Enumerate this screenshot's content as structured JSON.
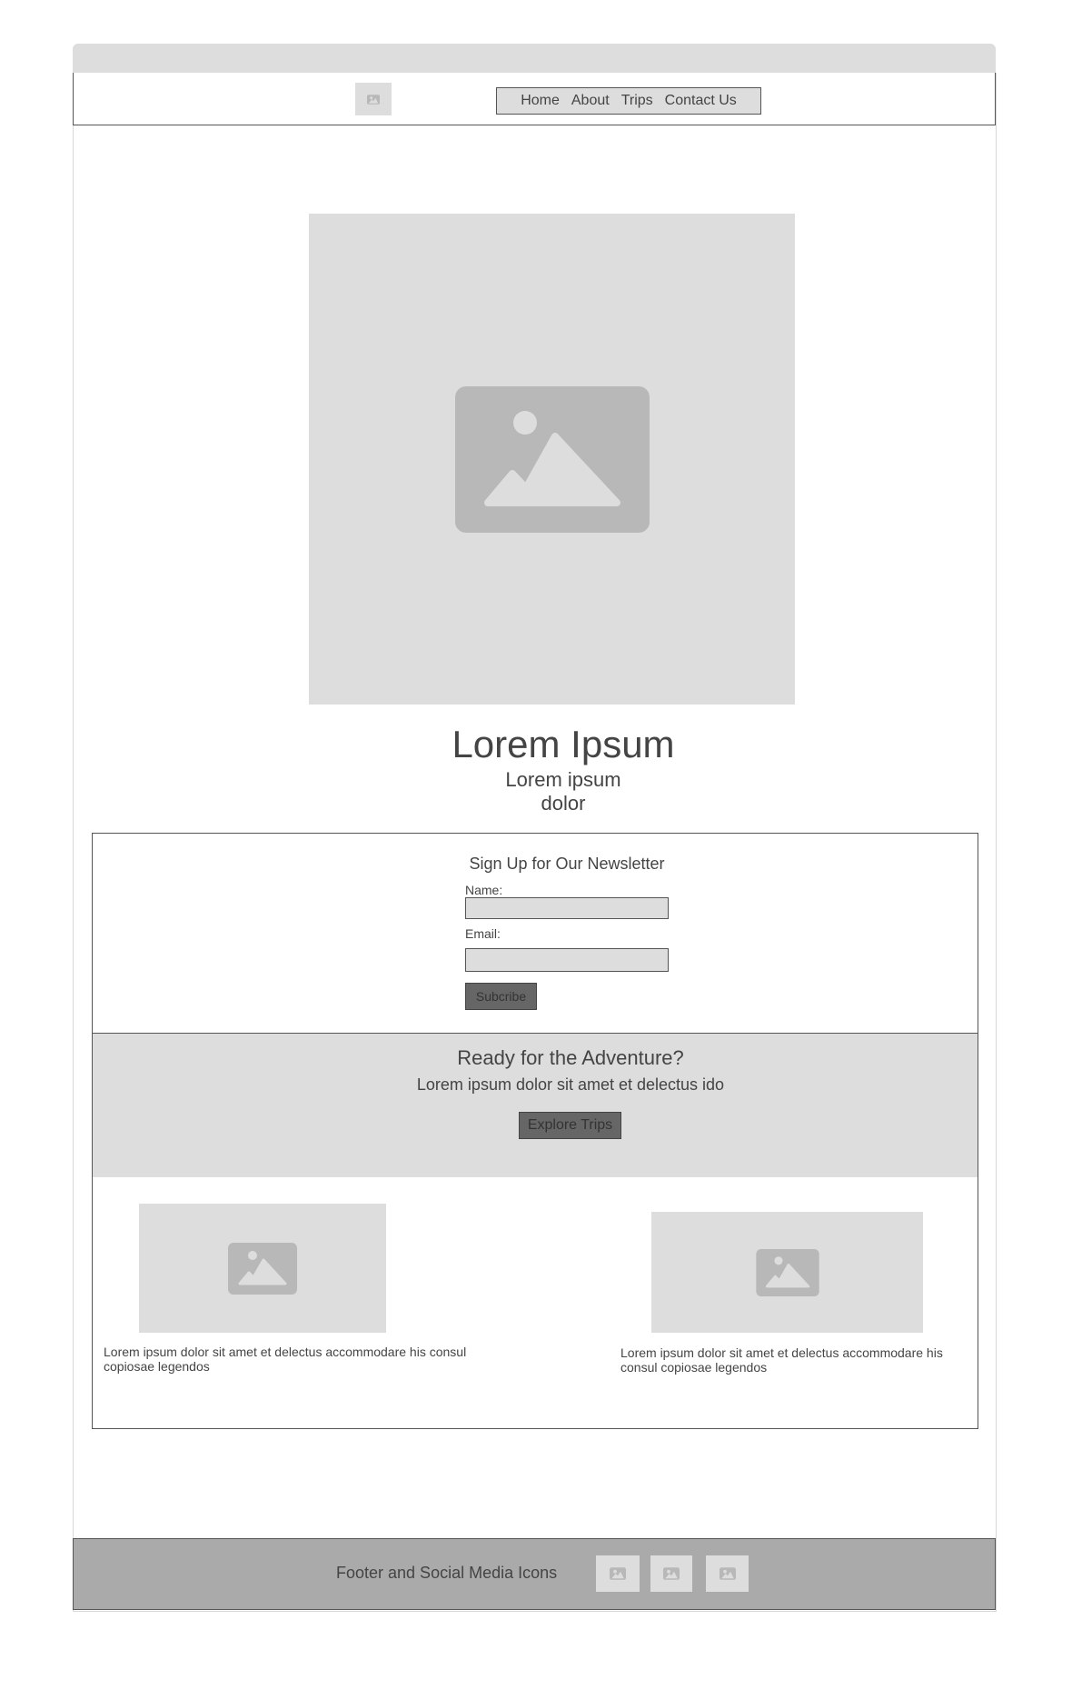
{
  "header": {
    "logo_icon": "image-placeholder-icon",
    "nav": [
      {
        "label": "Home"
      },
      {
        "label": "About"
      },
      {
        "label": "Trips"
      },
      {
        "label": "Contact Us"
      }
    ]
  },
  "hero": {
    "image_icon": "image-placeholder-icon",
    "title": "Lorem Ipsum",
    "subtitle_line1": "Lorem ipsum",
    "subtitle_line2": "dolor"
  },
  "newsletter": {
    "title": "Sign Up for Our Newsletter",
    "name_label": "Name:",
    "name_value": "",
    "email_label": "Email:",
    "email_value": "",
    "button": "Subcribe"
  },
  "cta": {
    "title": "Ready for the Adventure?",
    "text": "Lorem ipsum dolor sit amet et delectus ido",
    "button": "Explore Trips"
  },
  "cards": [
    {
      "image_icon": "image-placeholder-icon",
      "text": "Lorem ipsum dolor sit amet et delectus accommodare his consul copiosae legendos"
    },
    {
      "image_icon": "image-placeholder-icon",
      "text": "Lorem ipsum dolor sit amet et delectus accommodare his consul copiosae legendos"
    }
  ],
  "footer": {
    "text": "Footer and Social Media Icons",
    "social_icons": [
      "image-placeholder-icon",
      "image-placeholder-icon",
      "image-placeholder-icon"
    ]
  },
  "colors": {
    "placeholder": "#dddddd",
    "placeholder_icon": "#b8b8b8",
    "border": "#555555",
    "button": "#666666",
    "footer": "#aaaaaa",
    "text": "#444444"
  }
}
